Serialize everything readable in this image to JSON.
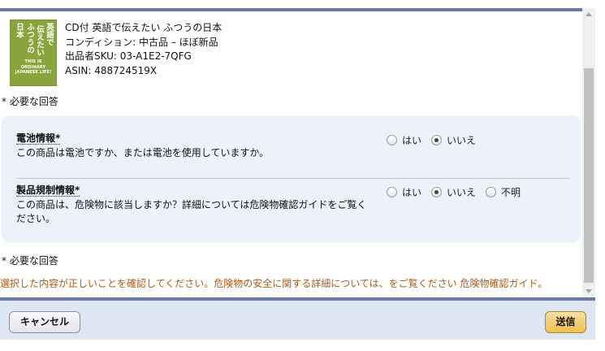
{
  "product": {
    "title": "CD付 英語で伝えたい ふつうの日本",
    "condition": "コンディション: 中古品 – ほぼ新品",
    "sku": "出品者SKU: 03-A1E2-7QFG",
    "asin": "ASIN: 488724519X",
    "cover": {
      "col1": "英語で",
      "col2": "伝えたい",
      "col3": "ふつうの",
      "col4": "日本",
      "english_1": "THIS IS",
      "english_2": "ORDINARY",
      "english_3": "JAPANESE LIFE!",
      "color": "#8aa43c"
    }
  },
  "required_label": "* 必要な回答",
  "questions": [
    {
      "title": "電池情報*",
      "description": "この商品は電池ですか、または電池を使用していますか。",
      "options": [
        {
          "label": "はい",
          "selected": false
        },
        {
          "label": "いいえ",
          "selected": true
        }
      ]
    },
    {
      "title": "製品規制情報*",
      "description": "この商品は、危険物に該当しますか？詳細については危険物確認ガイドをご覧ください。",
      "options": [
        {
          "label": "はい",
          "selected": false
        },
        {
          "label": "いいえ",
          "selected": true
        },
        {
          "label": "不明",
          "selected": false
        }
      ]
    }
  ],
  "note": "選択した内容が正しいことを確認してください。危険物の安全に関する詳細については、をご覧ください 危険物確認ガイド。",
  "buttons": {
    "cancel": "キャンセル",
    "submit": "送信"
  },
  "colors": {
    "accent_bar": "#6a7aa8",
    "panel_bg": "#edf2fa",
    "note_text": "#b05a16",
    "submit_button": "#f0c14b"
  }
}
